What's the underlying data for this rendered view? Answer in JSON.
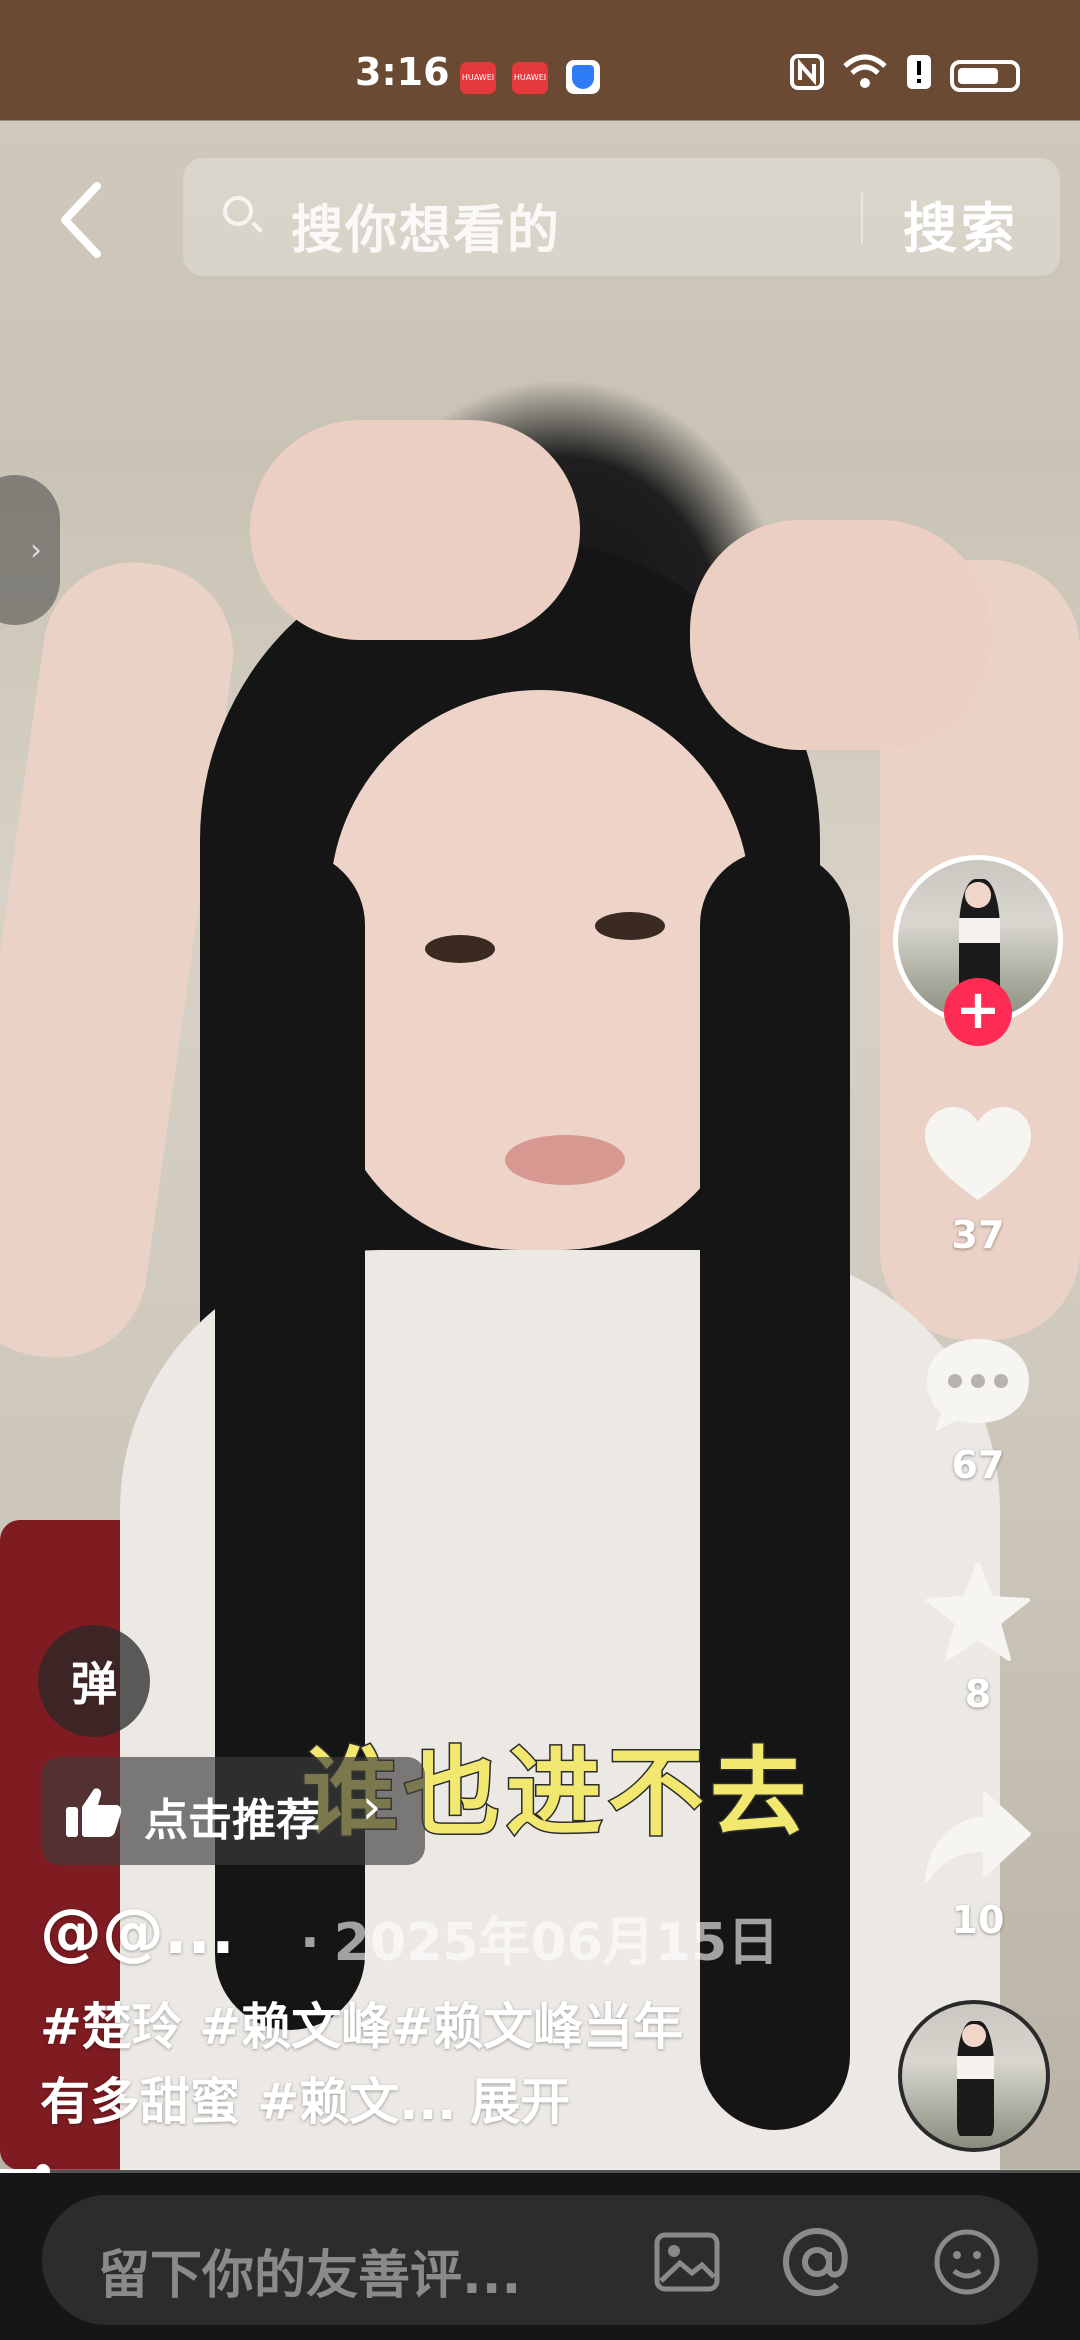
{
  "status_bar": {
    "time": "3:16",
    "app_badge": "HUAWEI"
  },
  "search": {
    "placeholder": "搜你想看的",
    "button_label": "搜索"
  },
  "video": {
    "caption": "谁也进不去",
    "progress_percent": 4
  },
  "actions": {
    "likes": "37",
    "comments": "67",
    "favorites": "8",
    "shares": "10"
  },
  "danmaku": {
    "label": "弹"
  },
  "recommend": {
    "label": "点击推荐"
  },
  "post": {
    "author": "@@...",
    "date": "2025年06月15日",
    "description": "#楚玲 #赖文峰#赖文峰当年有多甜蜜 #赖文...",
    "expand_label": "展开"
  },
  "comment_bar": {
    "placeholder": "留下你的友善评..."
  },
  "colors": {
    "follow_accent": "#fe2c55",
    "caption_yellow": "#f2e86f"
  },
  "icons": [
    "back-arrow-icon",
    "search-icon",
    "heart-icon",
    "comment-icon",
    "star-icon",
    "share-icon",
    "thumbs-up-icon",
    "image-icon",
    "at-icon",
    "emoji-icon",
    "nfc-icon",
    "wifi-icon",
    "battery-icon"
  ]
}
